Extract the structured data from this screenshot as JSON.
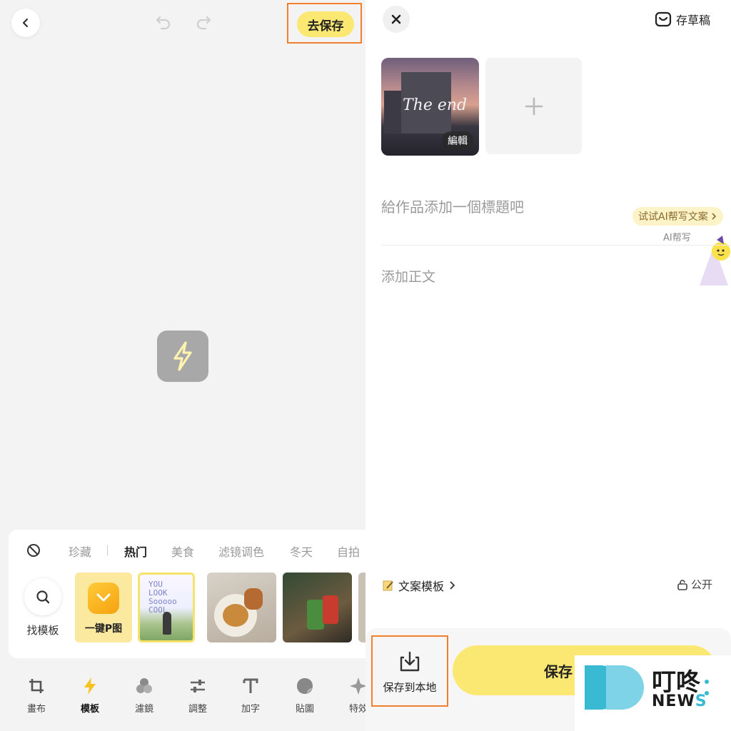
{
  "editor": {
    "save_go_label": "去保存",
    "categories": [
      "珍藏",
      "热门",
      "美食",
      "滤镜调色",
      "冬天",
      "自拍"
    ],
    "find_template_label": "找模板",
    "templates": [
      {
        "label": "一键P图"
      },
      {
        "label": "YOU LOOK Sooooo COOL"
      },
      {
        "label": ""
      },
      {
        "label": ""
      }
    ],
    "tools": [
      {
        "label": "畫布",
        "icon": "crop-icon"
      },
      {
        "label": "模板",
        "icon": "lightning-icon",
        "active": true
      },
      {
        "label": "濾鏡",
        "icon": "filter-circles-icon"
      },
      {
        "label": "調整",
        "icon": "sliders-icon"
      },
      {
        "label": "加字",
        "icon": "text-icon"
      },
      {
        "label": "貼圖",
        "icon": "sticker-icon"
      },
      {
        "label": "特效",
        "icon": "sparkle-icon"
      }
    ]
  },
  "post": {
    "draft_label": "存草稿",
    "photo_edit_badge": "編輯",
    "photo_overlay_text": "The end",
    "title_placeholder": "給作品添加一個標題吧",
    "ai_try_label": "试试AI帮写文案",
    "ai_write_label": "AI帮写",
    "body_placeholder": "添加正文",
    "template_link_label": "文案模板",
    "visibility_label": "公开",
    "save_local_label": "保存到本地",
    "save_main_label": "保存"
  },
  "watermark": {
    "cn": "叮咚",
    "en_main": "NEW",
    "en_tail": "S"
  },
  "colors": {
    "accent_yellow": "#fbe873",
    "highlight_orange": "#f07f2e",
    "brand_cyan": "#3ab9d3"
  }
}
